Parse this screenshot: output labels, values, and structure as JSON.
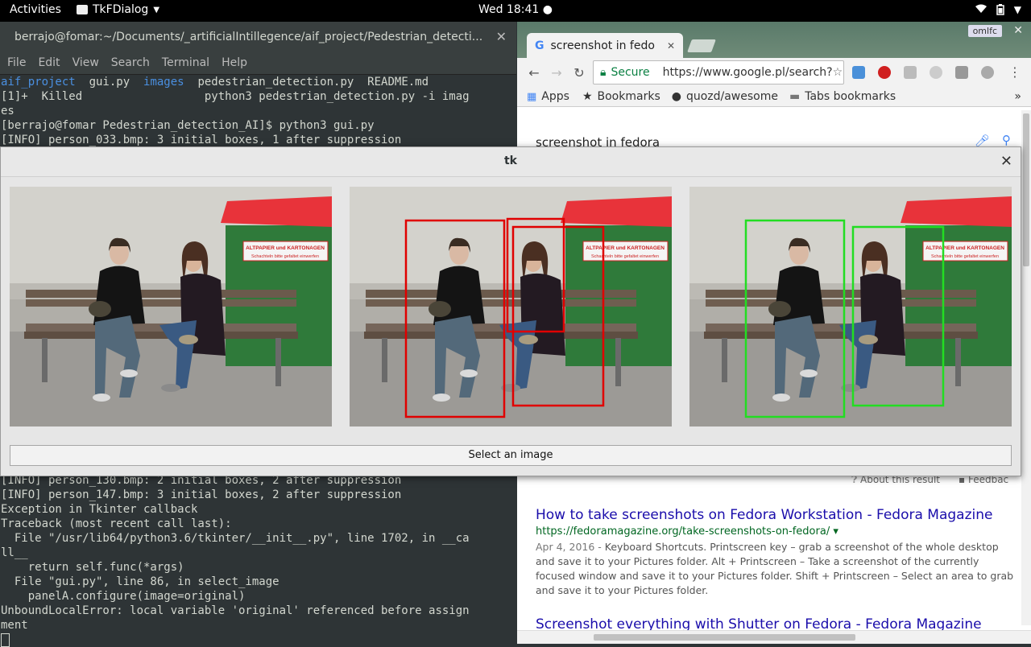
{
  "topbar": {
    "activities": "Activities",
    "app_name": "TkFDialog",
    "clock": "Wed 18:41 ●"
  },
  "terminal": {
    "title": "berrajo@fomar:~/Documents/_artificialIntillegence/aif_project/Pedestrian_detecti...",
    "menu": [
      "File",
      "Edit",
      "View",
      "Search",
      "Terminal",
      "Help"
    ],
    "upper_lines": [
      {
        "parts": [
          {
            "t": "aif_project",
            "c": "blue"
          },
          {
            "t": "  gui.py  "
          },
          {
            "t": "images",
            "c": "blue"
          },
          {
            "t": "  pedestrian_detection.py  README.md"
          }
        ]
      },
      {
        "parts": [
          {
            "t": "[1]+  Killed                  python3 pedestrian_detection.py -i imag"
          }
        ]
      },
      {
        "parts": [
          {
            "t": "es"
          }
        ]
      },
      {
        "parts": [
          {
            "t": "[berrajo@fomar Pedestrian_detection_AI]$ python3 gui.py"
          }
        ]
      },
      {
        "parts": [
          {
            "t": "[INFO] person_033.bmp: 3 initial boxes, 1 after suppression"
          }
        ]
      }
    ],
    "lower_lines": [
      "[INFO] person_130.bmp: 2 initial boxes, 2 after suppression",
      "[INFO] person_147.bmp: 3 initial boxes, 2 after suppression",
      "Exception in Tkinter callback",
      "Traceback (most recent call last):",
      "  File \"/usr/lib64/python3.6/tkinter/__init__.py\", line 1702, in __ca",
      "ll__",
      "    return self.func(*args)",
      "  File \"gui.py\", line 86, in select_image",
      "    panelA.configure(image=original)",
      "UnboundLocalError: local variable 'original' referenced before assign",
      "ment"
    ]
  },
  "chrome": {
    "tab_title": "screenshot in fedora",
    "profile": "omlfc",
    "secure": "Secure",
    "url": "https://www.google.pl/search?",
    "bookmarks": [
      "Apps",
      "Bookmarks",
      "quozd/awesome",
      "Tabs bookmarks"
    ],
    "search_query": "screenshot in fedora",
    "about": "About this result",
    "feedback": "Feedbac",
    "results": [
      {
        "title": "How to take screenshots on Fedora Workstation - Fedora Magazine",
        "link": "https://fedoramagazine.org/take-screenshots-on-fedora/",
        "date": "Apr 4, 2016 - ",
        "snippet": "Keyboard Shortcuts. Printscreen key – grab a screenshot of the whole desktop and save it to your Pictures folder. Alt + Printscreen – Take a screenshot of the currently focused window and save it to your Pictures folder. Shift + Printscreen – Select an area to grab and save it to your Pictures folder."
      },
      {
        "title": "Screenshot everything with Shutter on Fedora - Fedora Magazine"
      }
    ]
  },
  "tk": {
    "title": "tk",
    "sign_text": "ALTPAPIER und KARTONAGEN",
    "sign_sub": "Schachteln bitte gefaltet einwerfen",
    "select_button": "Select an image",
    "colors": {
      "before_suppression": "#e00000",
      "after_suppression": "#22dd22"
    }
  }
}
